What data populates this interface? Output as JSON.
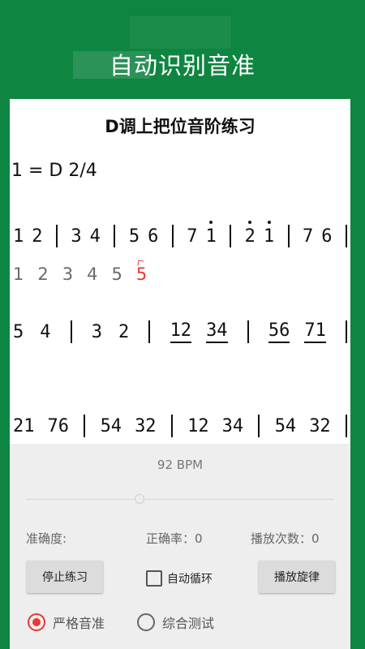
{
  "app": {
    "title": "自动识别音准"
  },
  "sheet": {
    "title": "D调上把位音阶练习",
    "key_signature": "1 = D  2/4",
    "row1": [
      "1",
      "2",
      "3",
      "4",
      "5",
      "6",
      "7",
      "1",
      "2",
      "1",
      "7",
      "6"
    ],
    "sung": [
      "1",
      "2",
      "3",
      "4",
      "5",
      "5"
    ],
    "row2": [
      "5",
      "4",
      "3",
      "2",
      "12",
      "34",
      "56",
      "71"
    ],
    "row3": [
      "21",
      "76",
      "54",
      "32",
      "12",
      "34",
      "54",
      "32"
    ]
  },
  "controls": {
    "bpm": "92 BPM",
    "tempo_level": 0.3,
    "accuracy_label": "准确度:",
    "correct_rate_label": "正确率：0",
    "play_count_label": "播放次数：0",
    "stop_button": "停止练习",
    "auto_loop": "自动循环",
    "play_button": "播放旋律",
    "radio_strict": "严格音准",
    "radio_combined": "综合测试"
  },
  "colors": {
    "brand_green": "#0e8540",
    "error_red": "#e53935"
  }
}
